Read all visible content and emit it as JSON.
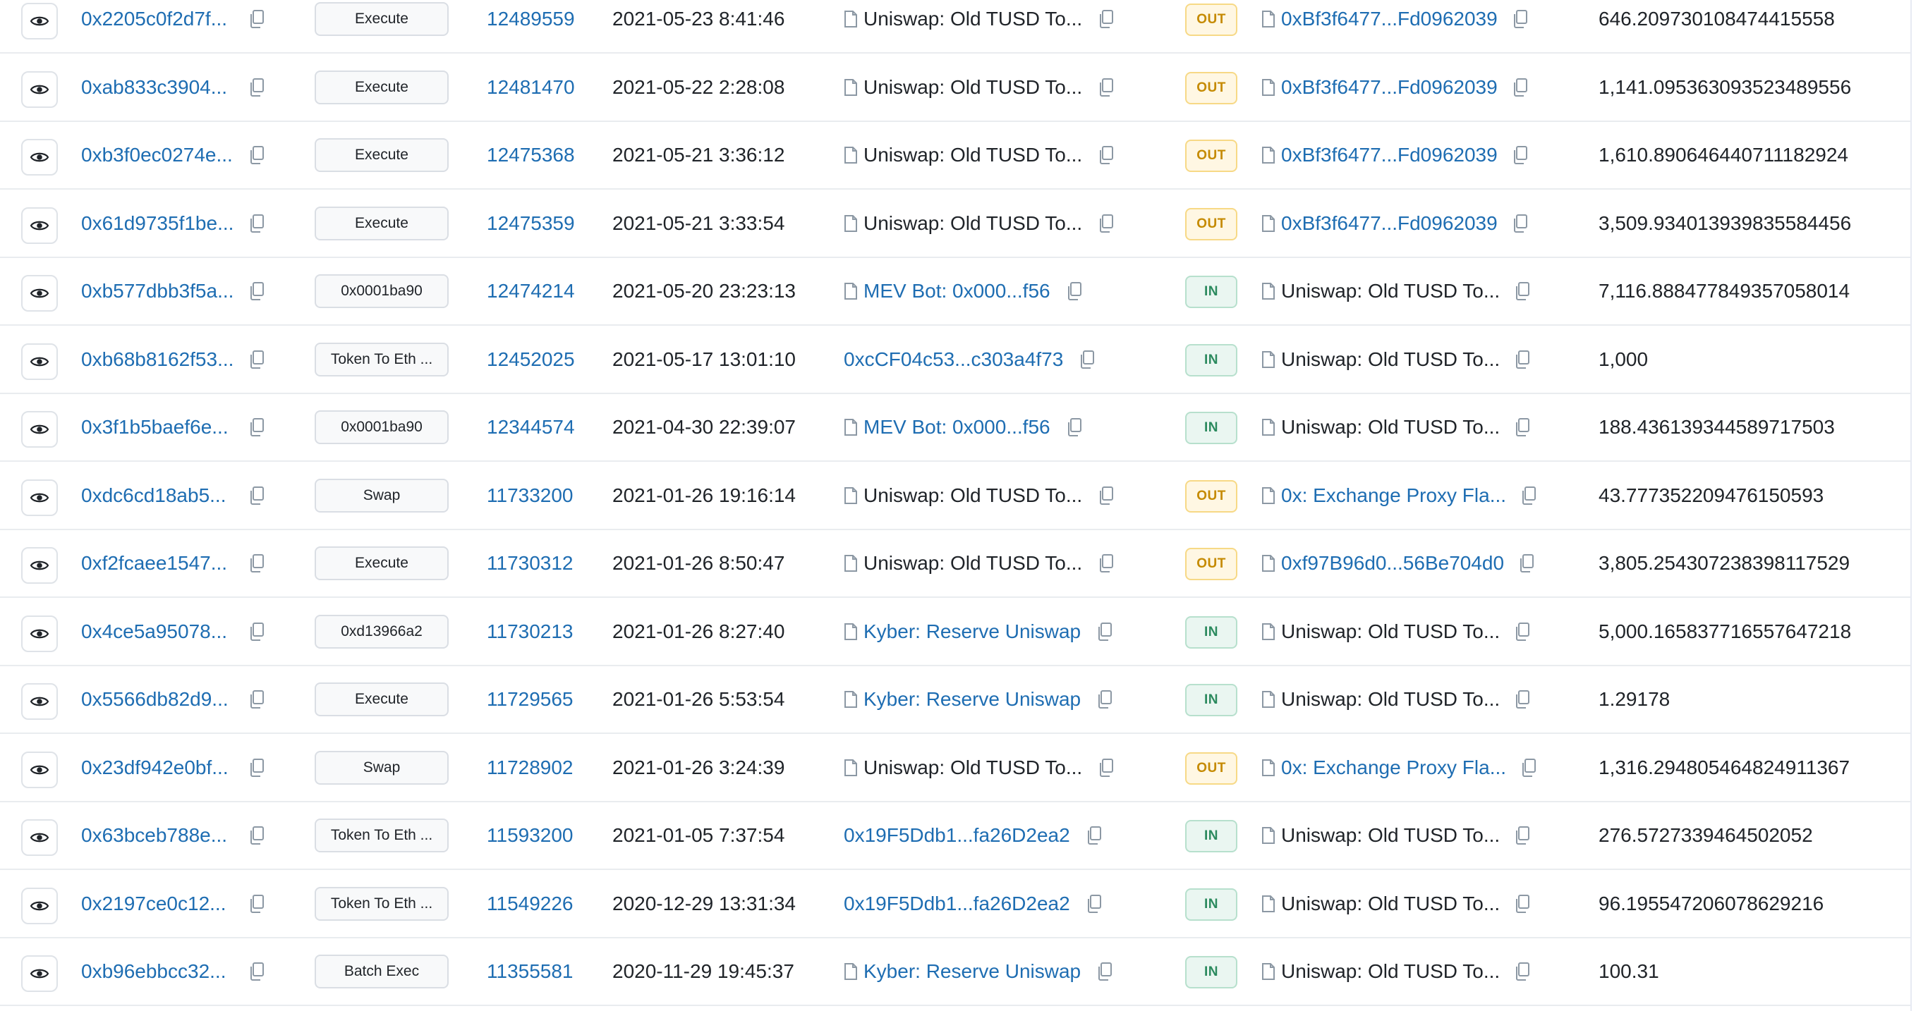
{
  "table": {
    "rows": [
      {
        "hash": "0x2205c0f2d7f...",
        "method": "Execute",
        "block": "12489559",
        "age": "2021-05-23 8:41:46",
        "from": "Uniswap: Old TUSD To...",
        "from_link": false,
        "from_doc": true,
        "direction": "OUT",
        "to": "0xBf3f6477...Fd0962039",
        "to_link": true,
        "value": "646.209730108474415558"
      },
      {
        "hash": "0xab833c3904...",
        "method": "Execute",
        "block": "12481470",
        "age": "2021-05-22 2:28:08",
        "from": "Uniswap: Old TUSD To...",
        "from_link": false,
        "from_doc": true,
        "direction": "OUT",
        "to": "0xBf3f6477...Fd0962039",
        "to_link": true,
        "value": "1,141.095363093523489556"
      },
      {
        "hash": "0xb3f0ec0274e...",
        "method": "Execute",
        "block": "12475368",
        "age": "2021-05-21 3:36:12",
        "from": "Uniswap: Old TUSD To...",
        "from_link": false,
        "from_doc": true,
        "direction": "OUT",
        "to": "0xBf3f6477...Fd0962039",
        "to_link": true,
        "value": "1,610.890646440711182924"
      },
      {
        "hash": "0x61d9735f1be...",
        "method": "Execute",
        "block": "12475359",
        "age": "2021-05-21 3:33:54",
        "from": "Uniswap: Old TUSD To...",
        "from_link": false,
        "from_doc": true,
        "direction": "OUT",
        "to": "0xBf3f6477...Fd0962039",
        "to_link": true,
        "value": "3,509.934013939835584456"
      },
      {
        "hash": "0xb577dbb3f5a...",
        "method": "0x0001ba90",
        "block": "12474214",
        "age": "2021-05-20 23:23:13",
        "from": "MEV Bot: 0x000...f56",
        "from_link": true,
        "from_doc": true,
        "direction": "IN",
        "to": "Uniswap: Old TUSD To...",
        "to_link": false,
        "value": "7,116.888477849357058014"
      },
      {
        "hash": "0xb68b8162f53...",
        "method": "Token To Eth ...",
        "block": "12452025",
        "age": "2021-05-17 13:01:10",
        "from": "0xcCF04c53...c303a4f73",
        "from_link": true,
        "from_doc": false,
        "direction": "IN",
        "to": "Uniswap: Old TUSD To...",
        "to_link": false,
        "value": "1,000"
      },
      {
        "hash": "0x3f1b5baef6e...",
        "method": "0x0001ba90",
        "block": "12344574",
        "age": "2021-04-30 22:39:07",
        "from": "MEV Bot: 0x000...f56",
        "from_link": true,
        "from_doc": true,
        "direction": "IN",
        "to": "Uniswap: Old TUSD To...",
        "to_link": false,
        "value": "188.436139344589717503"
      },
      {
        "hash": "0xdc6cd18ab5...",
        "method": "Swap",
        "block": "11733200",
        "age": "2021-01-26 19:16:14",
        "from": "Uniswap: Old TUSD To...",
        "from_link": false,
        "from_doc": true,
        "direction": "OUT",
        "to": "0x: Exchange Proxy Fla...",
        "to_link": true,
        "value": "43.777352209476150593"
      },
      {
        "hash": "0xf2fcaee1547...",
        "method": "Execute",
        "block": "11730312",
        "age": "2021-01-26 8:50:47",
        "from": "Uniswap: Old TUSD To...",
        "from_link": false,
        "from_doc": true,
        "direction": "OUT",
        "to": "0xf97B96d0...56Be704d0",
        "to_link": true,
        "value": "3,805.254307238398117529"
      },
      {
        "hash": "0x4ce5a95078...",
        "method": "0xd13966a2",
        "block": "11730213",
        "age": "2021-01-26 8:27:40",
        "from": "Kyber: Reserve Uniswap",
        "from_link": true,
        "from_doc": true,
        "direction": "IN",
        "to": "Uniswap: Old TUSD To...",
        "to_link": false,
        "value": "5,000.165837716557647218"
      },
      {
        "hash": "0x5566db82d9...",
        "method": "Execute",
        "block": "11729565",
        "age": "2021-01-26 5:53:54",
        "from": "Kyber: Reserve Uniswap",
        "from_link": true,
        "from_doc": true,
        "direction": "IN",
        "to": "Uniswap: Old TUSD To...",
        "to_link": false,
        "value": "1.29178"
      },
      {
        "hash": "0x23df942e0bf...",
        "method": "Swap",
        "block": "11728902",
        "age": "2021-01-26 3:24:39",
        "from": "Uniswap: Old TUSD To...",
        "from_link": false,
        "from_doc": true,
        "direction": "OUT",
        "to": "0x: Exchange Proxy Fla...",
        "to_link": true,
        "value": "1,316.294805464824911367"
      },
      {
        "hash": "0x63bceb788e...",
        "method": "Token To Eth ...",
        "block": "11593200",
        "age": "2021-01-05 7:37:54",
        "from": "0x19F5Ddb1...fa26D2ea2",
        "from_link": true,
        "from_doc": false,
        "direction": "IN",
        "to": "Uniswap: Old TUSD To...",
        "to_link": false,
        "value": "276.5727339464502052"
      },
      {
        "hash": "0x2197ce0c12...",
        "method": "Token To Eth ...",
        "block": "11549226",
        "age": "2020-12-29 13:31:34",
        "from": "0x19F5Ddb1...fa26D2ea2",
        "from_link": true,
        "from_doc": false,
        "direction": "IN",
        "to": "Uniswap: Old TUSD To...",
        "to_link": false,
        "value": "96.195547206078629216"
      },
      {
        "hash": "0xb96ebbcc32...",
        "method": "Batch Exec",
        "block": "11355581",
        "age": "2020-11-29 19:45:37",
        "from": "Kyber: Reserve Uniswap",
        "from_link": true,
        "from_doc": true,
        "direction": "IN",
        "to": "Uniswap: Old TUSD To...",
        "to_link": false,
        "value": "100.31"
      }
    ]
  },
  "colors": {
    "link": "#1e6db2",
    "out_badge": "#c58a00",
    "in_badge": "#2b8a5e"
  },
  "icons": {
    "view": "eye-icon",
    "copy": "copy-icon",
    "contract": "document-icon"
  }
}
